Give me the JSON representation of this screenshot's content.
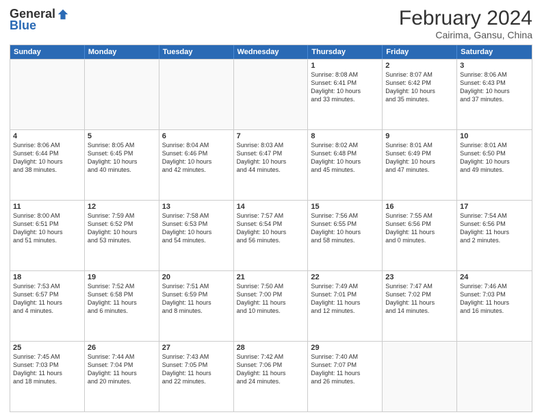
{
  "header": {
    "logo_general": "General",
    "logo_blue": "Blue",
    "month_year": "February 2024",
    "location": "Cairima, Gansu, China"
  },
  "days_of_week": [
    "Sunday",
    "Monday",
    "Tuesday",
    "Wednesday",
    "Thursday",
    "Friday",
    "Saturday"
  ],
  "weeks": [
    [
      {
        "day": "",
        "info": ""
      },
      {
        "day": "",
        "info": ""
      },
      {
        "day": "",
        "info": ""
      },
      {
        "day": "",
        "info": ""
      },
      {
        "day": "1",
        "info": "Sunrise: 8:08 AM\nSunset: 6:41 PM\nDaylight: 10 hours\nand 33 minutes."
      },
      {
        "day": "2",
        "info": "Sunrise: 8:07 AM\nSunset: 6:42 PM\nDaylight: 10 hours\nand 35 minutes."
      },
      {
        "day": "3",
        "info": "Sunrise: 8:06 AM\nSunset: 6:43 PM\nDaylight: 10 hours\nand 37 minutes."
      }
    ],
    [
      {
        "day": "4",
        "info": "Sunrise: 8:06 AM\nSunset: 6:44 PM\nDaylight: 10 hours\nand 38 minutes."
      },
      {
        "day": "5",
        "info": "Sunrise: 8:05 AM\nSunset: 6:45 PM\nDaylight: 10 hours\nand 40 minutes."
      },
      {
        "day": "6",
        "info": "Sunrise: 8:04 AM\nSunset: 6:46 PM\nDaylight: 10 hours\nand 42 minutes."
      },
      {
        "day": "7",
        "info": "Sunrise: 8:03 AM\nSunset: 6:47 PM\nDaylight: 10 hours\nand 44 minutes."
      },
      {
        "day": "8",
        "info": "Sunrise: 8:02 AM\nSunset: 6:48 PM\nDaylight: 10 hours\nand 45 minutes."
      },
      {
        "day": "9",
        "info": "Sunrise: 8:01 AM\nSunset: 6:49 PM\nDaylight: 10 hours\nand 47 minutes."
      },
      {
        "day": "10",
        "info": "Sunrise: 8:01 AM\nSunset: 6:50 PM\nDaylight: 10 hours\nand 49 minutes."
      }
    ],
    [
      {
        "day": "11",
        "info": "Sunrise: 8:00 AM\nSunset: 6:51 PM\nDaylight: 10 hours\nand 51 minutes."
      },
      {
        "day": "12",
        "info": "Sunrise: 7:59 AM\nSunset: 6:52 PM\nDaylight: 10 hours\nand 53 minutes."
      },
      {
        "day": "13",
        "info": "Sunrise: 7:58 AM\nSunset: 6:53 PM\nDaylight: 10 hours\nand 54 minutes."
      },
      {
        "day": "14",
        "info": "Sunrise: 7:57 AM\nSunset: 6:54 PM\nDaylight: 10 hours\nand 56 minutes."
      },
      {
        "day": "15",
        "info": "Sunrise: 7:56 AM\nSunset: 6:55 PM\nDaylight: 10 hours\nand 58 minutes."
      },
      {
        "day": "16",
        "info": "Sunrise: 7:55 AM\nSunset: 6:56 PM\nDaylight: 11 hours\nand 0 minutes."
      },
      {
        "day": "17",
        "info": "Sunrise: 7:54 AM\nSunset: 6:56 PM\nDaylight: 11 hours\nand 2 minutes."
      }
    ],
    [
      {
        "day": "18",
        "info": "Sunrise: 7:53 AM\nSunset: 6:57 PM\nDaylight: 11 hours\nand 4 minutes."
      },
      {
        "day": "19",
        "info": "Sunrise: 7:52 AM\nSunset: 6:58 PM\nDaylight: 11 hours\nand 6 minutes."
      },
      {
        "day": "20",
        "info": "Sunrise: 7:51 AM\nSunset: 6:59 PM\nDaylight: 11 hours\nand 8 minutes."
      },
      {
        "day": "21",
        "info": "Sunrise: 7:50 AM\nSunset: 7:00 PM\nDaylight: 11 hours\nand 10 minutes."
      },
      {
        "day": "22",
        "info": "Sunrise: 7:49 AM\nSunset: 7:01 PM\nDaylight: 11 hours\nand 12 minutes."
      },
      {
        "day": "23",
        "info": "Sunrise: 7:47 AM\nSunset: 7:02 PM\nDaylight: 11 hours\nand 14 minutes."
      },
      {
        "day": "24",
        "info": "Sunrise: 7:46 AM\nSunset: 7:03 PM\nDaylight: 11 hours\nand 16 minutes."
      }
    ],
    [
      {
        "day": "25",
        "info": "Sunrise: 7:45 AM\nSunset: 7:03 PM\nDaylight: 11 hours\nand 18 minutes."
      },
      {
        "day": "26",
        "info": "Sunrise: 7:44 AM\nSunset: 7:04 PM\nDaylight: 11 hours\nand 20 minutes."
      },
      {
        "day": "27",
        "info": "Sunrise: 7:43 AM\nSunset: 7:05 PM\nDaylight: 11 hours\nand 22 minutes."
      },
      {
        "day": "28",
        "info": "Sunrise: 7:42 AM\nSunset: 7:06 PM\nDaylight: 11 hours\nand 24 minutes."
      },
      {
        "day": "29",
        "info": "Sunrise: 7:40 AM\nSunset: 7:07 PM\nDaylight: 11 hours\nand 26 minutes."
      },
      {
        "day": "",
        "info": ""
      },
      {
        "day": "",
        "info": ""
      }
    ]
  ]
}
